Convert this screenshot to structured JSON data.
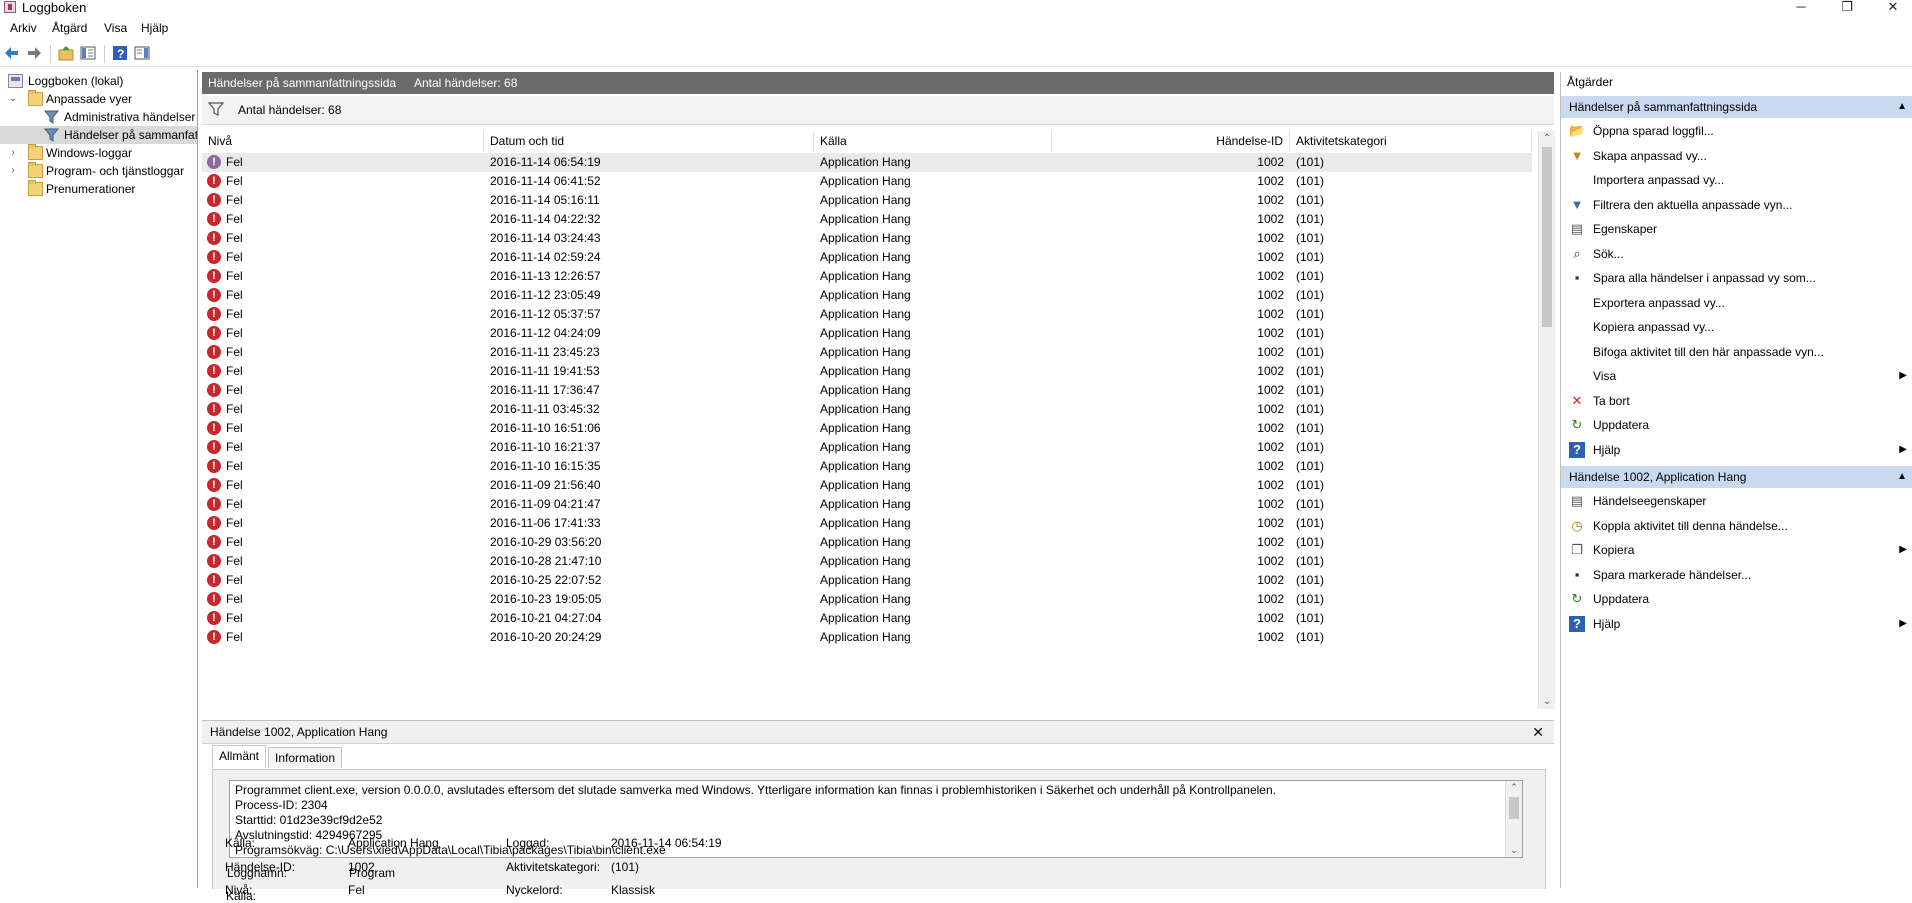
{
  "window": {
    "title": "Loggboken",
    "minimize": "─",
    "restore": "❐",
    "close": "✕"
  },
  "menu": [
    "Arkiv",
    "Åtgärd",
    "Visa",
    "Hjälp"
  ],
  "tree": {
    "root": "Loggboken (lokal)",
    "custom_views": "Anpassade vyer",
    "admin_events": "Administrativa händelser",
    "summary_events": "Händelser på sammanfattningssida",
    "windows_logs": "Windows-loggar",
    "app_logs": "Program- och tjänstloggar",
    "subscriptions": "Prenumerationer"
  },
  "main": {
    "header_title": "Händelser på sammanfattningssida",
    "header_count": "Antal händelser: 68",
    "filter_count": "Antal händelser: 68",
    "columns": {
      "level": "Nivå",
      "datetime": "Datum och tid",
      "source": "Källa",
      "event_id": "Händelse-ID",
      "category": "Aktivitetskategori"
    },
    "rows": [
      {
        "level": "Fel",
        "datetime": "2016-11-14 06:54:19",
        "source": "Application Hang",
        "event_id": "1002",
        "category": "(101)"
      },
      {
        "level": "Fel",
        "datetime": "2016-11-14 06:41:52",
        "source": "Application Hang",
        "event_id": "1002",
        "category": "(101)"
      },
      {
        "level": "Fel",
        "datetime": "2016-11-14 05:16:11",
        "source": "Application Hang",
        "event_id": "1002",
        "category": "(101)"
      },
      {
        "level": "Fel",
        "datetime": "2016-11-14 04:22:32",
        "source": "Application Hang",
        "event_id": "1002",
        "category": "(101)"
      },
      {
        "level": "Fel",
        "datetime": "2016-11-14 03:24:43",
        "source": "Application Hang",
        "event_id": "1002",
        "category": "(101)"
      },
      {
        "level": "Fel",
        "datetime": "2016-11-14 02:59:24",
        "source": "Application Hang",
        "event_id": "1002",
        "category": "(101)"
      },
      {
        "level": "Fel",
        "datetime": "2016-11-13 12:26:57",
        "source": "Application Hang",
        "event_id": "1002",
        "category": "(101)"
      },
      {
        "level": "Fel",
        "datetime": "2016-11-12 23:05:49",
        "source": "Application Hang",
        "event_id": "1002",
        "category": "(101)"
      },
      {
        "level": "Fel",
        "datetime": "2016-11-12 05:37:57",
        "source": "Application Hang",
        "event_id": "1002",
        "category": "(101)"
      },
      {
        "level": "Fel",
        "datetime": "2016-11-12 04:24:09",
        "source": "Application Hang",
        "event_id": "1002",
        "category": "(101)"
      },
      {
        "level": "Fel",
        "datetime": "2016-11-11 23:45:23",
        "source": "Application Hang",
        "event_id": "1002",
        "category": "(101)"
      },
      {
        "level": "Fel",
        "datetime": "2016-11-11 19:41:53",
        "source": "Application Hang",
        "event_id": "1002",
        "category": "(101)"
      },
      {
        "level": "Fel",
        "datetime": "2016-11-11 17:36:47",
        "source": "Application Hang",
        "event_id": "1002",
        "category": "(101)"
      },
      {
        "level": "Fel",
        "datetime": "2016-11-11 03:45:32",
        "source": "Application Hang",
        "event_id": "1002",
        "category": "(101)"
      },
      {
        "level": "Fel",
        "datetime": "2016-11-10 16:51:06",
        "source": "Application Hang",
        "event_id": "1002",
        "category": "(101)"
      },
      {
        "level": "Fel",
        "datetime": "2016-11-10 16:21:37",
        "source": "Application Hang",
        "event_id": "1002",
        "category": "(101)"
      },
      {
        "level": "Fel",
        "datetime": "2016-11-10 16:15:35",
        "source": "Application Hang",
        "event_id": "1002",
        "category": "(101)"
      },
      {
        "level": "Fel",
        "datetime": "2016-11-09 21:56:40",
        "source": "Application Hang",
        "event_id": "1002",
        "category": "(101)"
      },
      {
        "level": "Fel",
        "datetime": "2016-11-09 04:21:47",
        "source": "Application Hang",
        "event_id": "1002",
        "category": "(101)"
      },
      {
        "level": "Fel",
        "datetime": "2016-11-06 17:41:33",
        "source": "Application Hang",
        "event_id": "1002",
        "category": "(101)"
      },
      {
        "level": "Fel",
        "datetime": "2016-10-29 03:56:20",
        "source": "Application Hang",
        "event_id": "1002",
        "category": "(101)"
      },
      {
        "level": "Fel",
        "datetime": "2016-10-28 21:47:10",
        "source": "Application Hang",
        "event_id": "1002",
        "category": "(101)"
      },
      {
        "level": "Fel",
        "datetime": "2016-10-25 22:07:52",
        "source": "Application Hang",
        "event_id": "1002",
        "category": "(101)"
      },
      {
        "level": "Fel",
        "datetime": "2016-10-23 19:05:05",
        "source": "Application Hang",
        "event_id": "1002",
        "category": "(101)"
      },
      {
        "level": "Fel",
        "datetime": "2016-10-21 04:27:04",
        "source": "Application Hang",
        "event_id": "1002",
        "category": "(101)"
      },
      {
        "level": "Fel",
        "datetime": "2016-10-20 20:24:29",
        "source": "Application Hang",
        "event_id": "1002",
        "category": "(101)"
      }
    ]
  },
  "detail": {
    "title": "Händelse 1002, Application Hang",
    "close": "✕",
    "tabs": [
      "Allmänt",
      "Information"
    ],
    "description": [
      "Programmet client.exe, version 0.0.0.0, avslutades eftersom det slutade samverka med Windows. Ytterligare information kan finnas i problemhistoriken i Säkerhet och underhåll på Kontrollpanelen.",
      "Process-ID: 2304",
      "Starttid: 01d23e39cf9d2e52",
      "Avslutningstid: 4294967295",
      "Programsökväg: C:\\Users\\xied\\AppData\\Local\\Tibia\\packages\\Tibia\\bin\\client.exe"
    ],
    "props": {
      "log_name_label": "Loggnamn:",
      "log_name": "Program",
      "source_label": "Källa:",
      "source": "Application Hang",
      "logged_label": "Loggad:",
      "logged": "2016-11-14 06:54:19",
      "event_id_label": "Händelse-ID:",
      "event_id": "1002",
      "task_label": "Aktivitetskategori:",
      "task": "(101)",
      "level_label": "Nivå:",
      "level": "Fel",
      "keywords_label": "Nyckelord:",
      "keywords": "Klassisk"
    }
  },
  "actions": {
    "title": "Åtgärder",
    "section1": "Händelser på sammanfattningssida",
    "items1": [
      {
        "label": "Öppna sparad loggfil...",
        "icon": "open-log-icon"
      },
      {
        "label": "Skapa anpassad vy...",
        "icon": "create-view-icon"
      },
      {
        "label": "Importera anpassad vy...",
        "icon": ""
      },
      {
        "label": "Filtrera den aktuella anpassade vyn...",
        "icon": "filter-icon"
      },
      {
        "label": "Egenskaper",
        "icon": "properties-icon"
      },
      {
        "label": "Sök...",
        "icon": "find-icon"
      },
      {
        "label": "Spara alla händelser i anpassad vy som...",
        "icon": "save-icon"
      },
      {
        "label": "Exportera anpassad vy...",
        "icon": ""
      },
      {
        "label": "Kopiera anpassad vy...",
        "icon": ""
      },
      {
        "label": "Bifoga aktivitet till den här anpassade vyn...",
        "icon": ""
      },
      {
        "label": "Visa",
        "icon": ""
      },
      {
        "label": "Ta bort",
        "icon": "delete-icon"
      },
      {
        "label": "Uppdatera",
        "icon": "refresh-icon"
      },
      {
        "label": "Hjälp",
        "icon": "help-icon"
      }
    ],
    "section2": "Händelse 1002, Application Hang",
    "items2": [
      {
        "label": "Händelseegenskaper",
        "icon": "event-properties-icon"
      },
      {
        "label": "Koppla aktivitet till denna händelse...",
        "icon": "attach-task-icon"
      },
      {
        "label": "Kopiera",
        "icon": "copy-icon"
      },
      {
        "label": "Spara markerade händelser...",
        "icon": "save-icon"
      },
      {
        "label": "Uppdatera",
        "icon": "refresh-icon"
      },
      {
        "label": "Hjälp",
        "icon": "help-icon"
      }
    ]
  }
}
